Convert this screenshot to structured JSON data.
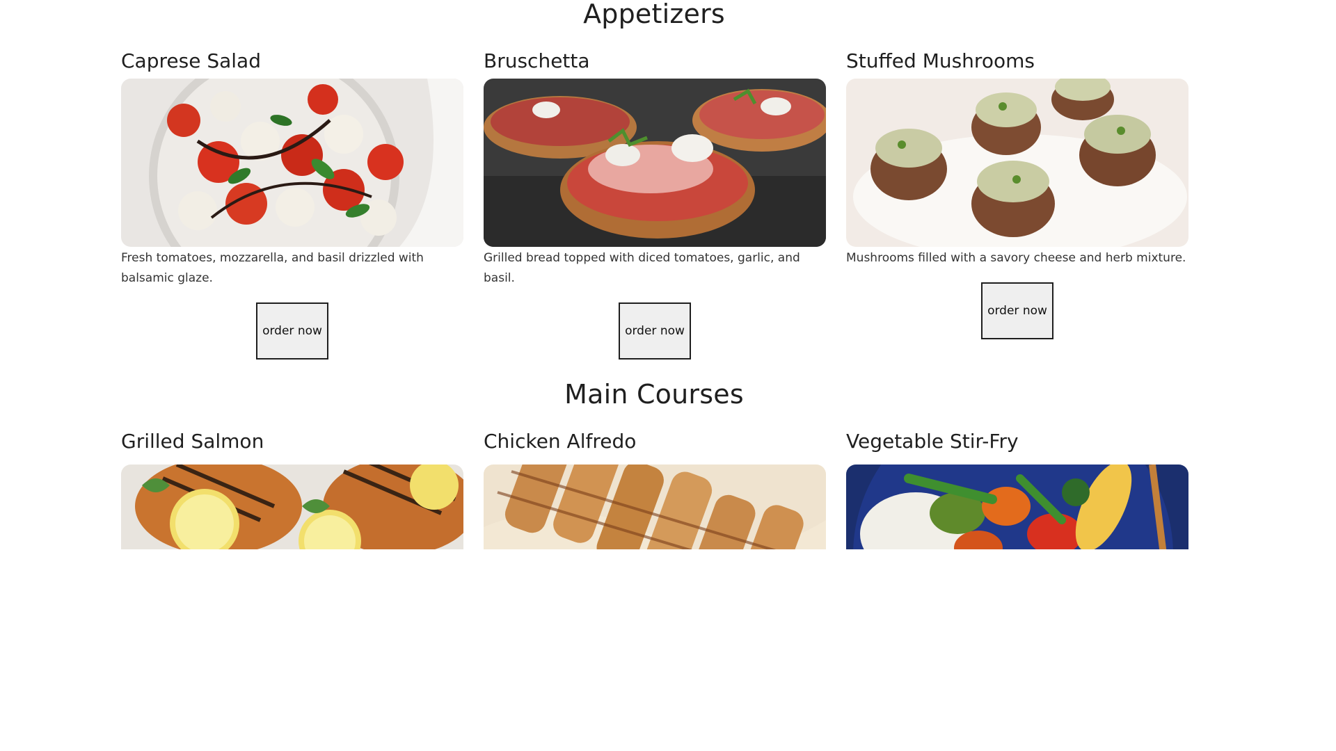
{
  "sections": [
    {
      "title": "Appetizers",
      "items": [
        {
          "name": "Caprese Salad",
          "description": "Fresh tomatoes, mozzarella, and basil drizzled with balsamic glaze.",
          "button": "order now",
          "image": "caprese-salad-photo"
        },
        {
          "name": "Bruschetta",
          "description": "Grilled bread topped with diced tomatoes, garlic, and basil.",
          "button": "order now",
          "image": "bruschetta-photo"
        },
        {
          "name": "Stuffed Mushrooms",
          "description": "Mushrooms filled with a savory cheese and herb mixture.",
          "button": "order now",
          "image": "stuffed-mushrooms-photo"
        }
      ]
    },
    {
      "title": "Main Courses",
      "items": [
        {
          "name": "Grilled Salmon",
          "image": "grilled-salmon-photo"
        },
        {
          "name": "Chicken Alfredo",
          "image": "chicken-alfredo-photo"
        },
        {
          "name": "Vegetable Stir-Fry",
          "image": "vegetable-stir-fry-photo"
        }
      ]
    }
  ]
}
